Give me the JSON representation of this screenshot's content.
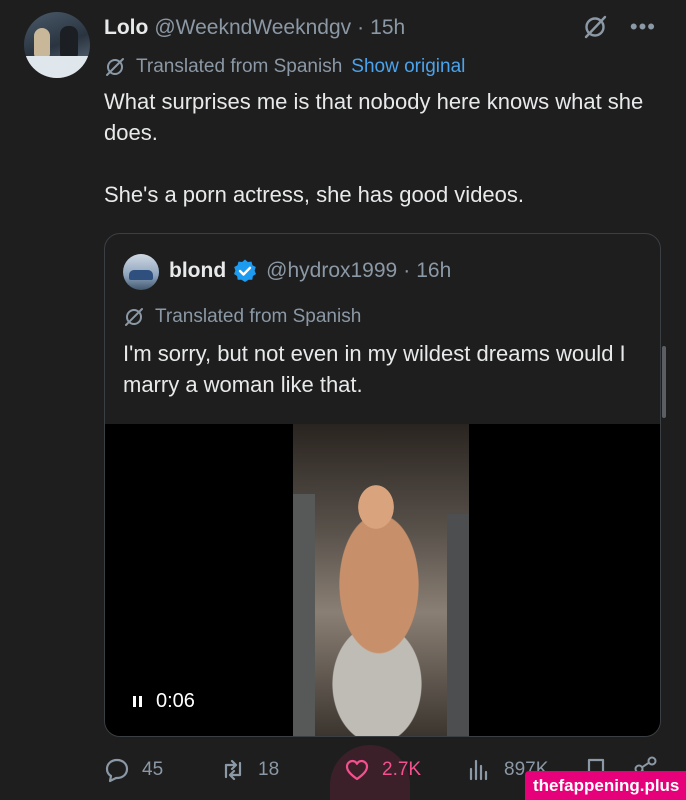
{
  "post": {
    "author": {
      "name": "Lolo",
      "handle": "@WeekndWeekndgv",
      "time": "15h"
    },
    "translation": {
      "label": "Translated from Spanish",
      "show_original": "Show original"
    },
    "text": [
      "What surprises me is that nobody here knows what she does.",
      "She's a porn actress, she has good videos."
    ]
  },
  "quote": {
    "author": {
      "name": "blond",
      "handle": "@hydrox1999",
      "time": "16h"
    },
    "translation": {
      "label": "Translated from Spanish"
    },
    "text": "I'm sorry, but not even in my wildest dreams would I marry a woman like that.",
    "video": {
      "timestamp": "0:06"
    }
  },
  "actions": {
    "replies": "45",
    "reposts": "18",
    "likes": "2.7K",
    "views": "897K"
  },
  "watermark": "thefappening.plus",
  "colors": {
    "accent_link": "#4aa3ec",
    "like": "#f4508f",
    "verified": "#1d9bf0",
    "muted": "#8b98a5"
  },
  "icons": [
    "grok-icon",
    "more-icon",
    "translate-icon",
    "verified-icon",
    "pause-icon",
    "reply-icon",
    "repost-icon",
    "like-icon",
    "views-icon",
    "bookmark-icon",
    "share-icon"
  ]
}
